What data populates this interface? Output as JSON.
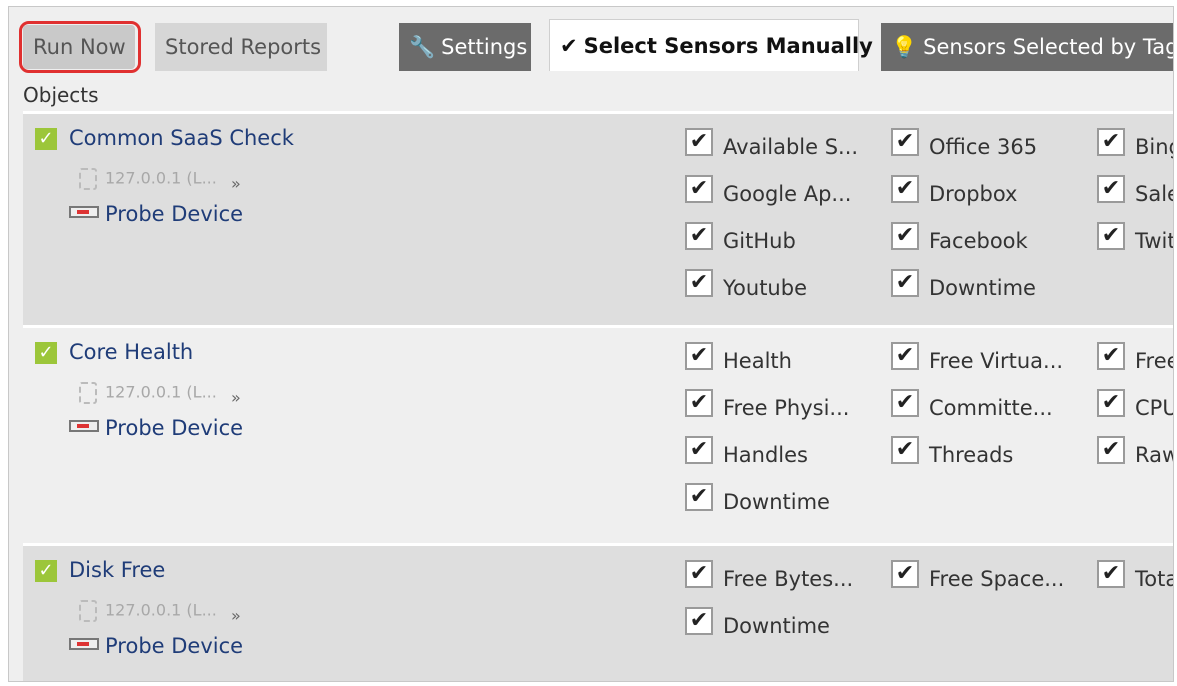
{
  "tabs": {
    "run_now": "Run Now",
    "stored_reports": "Stored Reports",
    "settings": "Settings",
    "select_manually": "Select Sensors Manually",
    "selected_by_tag": "Sensors Selected by Tag"
  },
  "objects_label": "Objects",
  "rows": [
    {
      "name": "Common SaaS Check",
      "ip": "127.0.0.1 (L...",
      "more": "»",
      "probe": "Probe Device",
      "sensors": [
        [
          "Available S...",
          "Office 365",
          "Bing"
        ],
        [
          "Google Ap...",
          "Dropbox",
          "Sale"
        ],
        [
          "GitHub",
          "Facebook",
          "Twit"
        ],
        [
          "Youtube",
          "Downtime",
          ""
        ]
      ]
    },
    {
      "name": "Core Health",
      "ip": "127.0.0.1 (L...",
      "more": "»",
      "probe": "Probe Device",
      "sensors": [
        [
          "Health",
          "Free Virtua...",
          "Free"
        ],
        [
          "Free Physi...",
          "Committe...",
          "CPU"
        ],
        [
          "Handles",
          "Threads",
          "Raw"
        ],
        [
          "Downtime",
          "",
          ""
        ]
      ]
    },
    {
      "name": "Disk Free",
      "ip": "127.0.0.1 (L...",
      "more": "»",
      "probe": "Probe Device",
      "sensors": [
        [
          "Free Bytes...",
          "Free Space...",
          "Tota"
        ],
        [
          "Downtime",
          "",
          ""
        ]
      ]
    }
  ],
  "icons": {
    "settings": "wrench-icon",
    "select": "checkmark-icon",
    "tag": "lightbulb-icon",
    "checkbox_checked": "check-icon"
  },
  "colors": {
    "object_check": "#9cc63a",
    "link": "#1f3c78",
    "highlight": "#e03030"
  }
}
